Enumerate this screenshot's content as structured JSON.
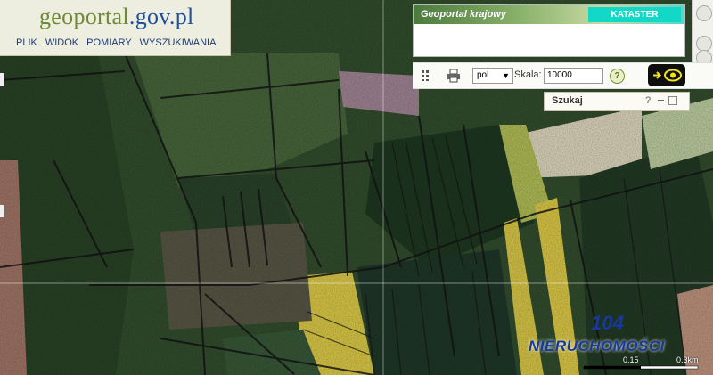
{
  "app": {
    "logo_main": "geoportal",
    "logo_domain": ".gov.pl"
  },
  "menu": {
    "items": [
      "PLIK",
      "WIDOK",
      "POMIARY",
      "WYSZUKIWANIA"
    ]
  },
  "layer_header": {
    "title": "Geoportal krajowy",
    "badge": "KATASTER"
  },
  "toolbar": {
    "unit_select": "pol",
    "scale_label": "Skala:",
    "scale_value": "10000",
    "help_label": "?"
  },
  "search_panel": {
    "title": "Szukaj",
    "help_label": "?"
  },
  "scale_bar": {
    "labels": [
      "0.15",
      "0.3km"
    ]
  },
  "watermark": {
    "number": "104",
    "text": "NIERUCHOMOŚCI"
  },
  "colors": {
    "brand_green": "#6f8a35",
    "brand_blue": "#1f4f9a",
    "kataster_badge": "#12d8c8",
    "watermark": "#163a9a",
    "active_button": "#1e7fd9"
  },
  "icons": {
    "grid": "grid-icon",
    "print": "printer-icon",
    "eye": "eye-icon",
    "arrow": "arrow-right-icon"
  }
}
